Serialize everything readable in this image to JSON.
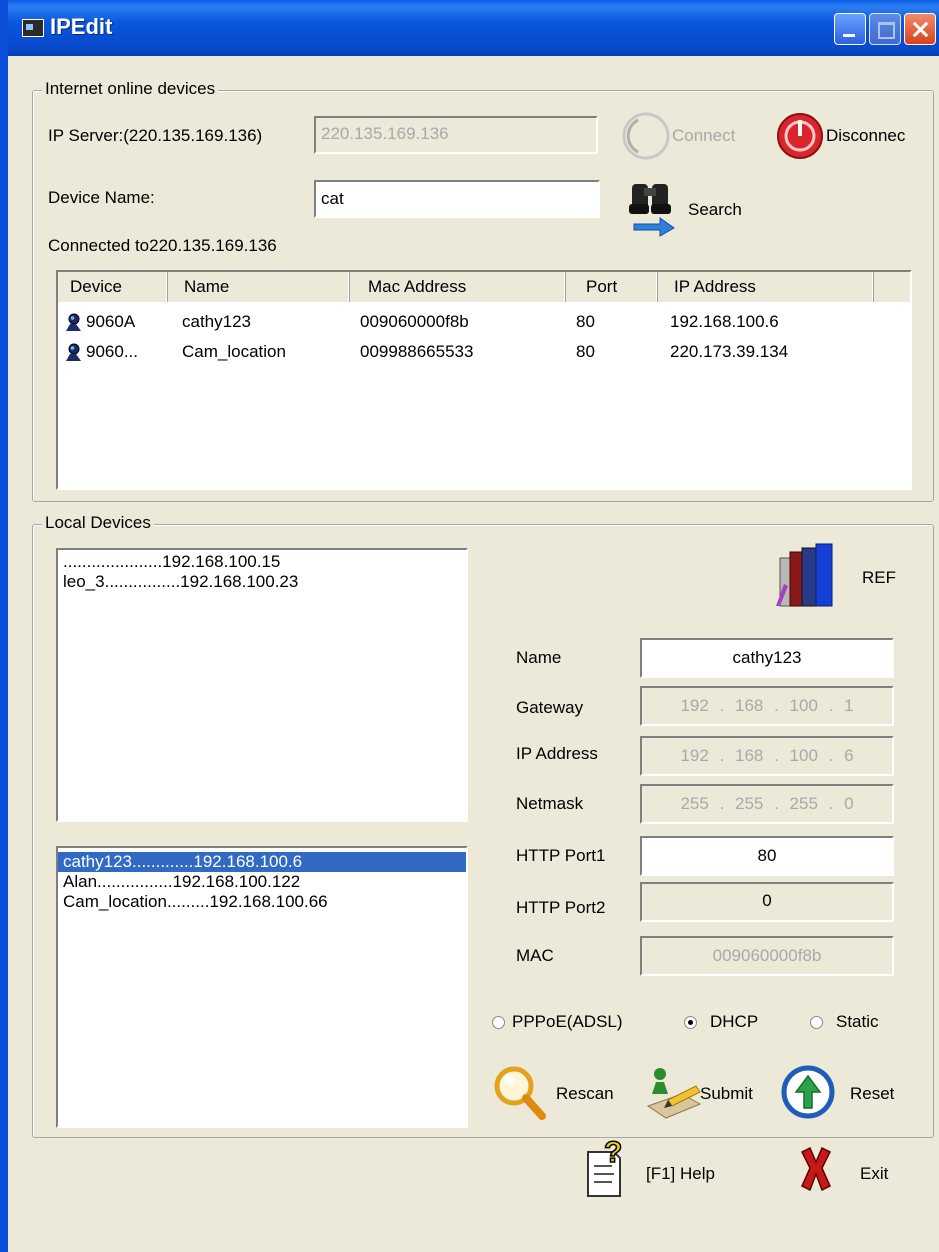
{
  "window": {
    "title": "IPEdit"
  },
  "online": {
    "legend": "Internet online devices",
    "ip_server_label": "IP Server:(220.135.169.136)",
    "ip_server_value": "220.135.169.136",
    "connect_label": "Connect",
    "disconnect_label": "Disconnec",
    "device_name_label": "Device Name:",
    "device_name_value": "cat",
    "search_label": "Search",
    "status": "Connected to220.135.169.136",
    "columns": [
      "Device",
      "Name",
      "Mac Address",
      "Port",
      "IP Address"
    ],
    "rows": [
      {
        "device": "9060A",
        "name": "cathy123",
        "mac": "009060000f8b",
        "port": "80",
        "ip": "192.168.100.6"
      },
      {
        "device": "9060...",
        "name": "Cam_location",
        "mac": "009988665533",
        "port": "80",
        "ip": "220.173.39.134"
      }
    ]
  },
  "local": {
    "legend": "Local Devices",
    "list_top": [
      ".....................192.168.100.15",
      "leo_3................192.168.100.23"
    ],
    "list_bottom": [
      {
        "text": "cathy123.............192.168.100.6",
        "selected": true
      },
      {
        "text": "Alan................192.168.100.122",
        "selected": false
      },
      {
        "text": "Cam_location.........192.168.100.66",
        "selected": false
      }
    ],
    "ref_label": "REF",
    "fields": {
      "name_label": "Name",
      "name_value": "cathy123",
      "gateway_label": "Gateway",
      "gateway_value": "192 . 168 . 100 . 1",
      "ip_label": "IP Address",
      "ip_value": "192 . 168 . 100 . 6",
      "netmask_label": "Netmask",
      "netmask_value": "255 . 255 . 255 . 0",
      "port1_label": "HTTP Port1",
      "port1_value": "80",
      "port2_label": "HTTP Port2",
      "port2_value": "0",
      "mac_label": "MAC",
      "mac_value": "009060000f8b"
    },
    "modes": {
      "pppoe": "PPPoE(ADSL)",
      "dhcp": "DHCP",
      "static": "Static",
      "selected": "DHCP"
    },
    "rescan_label": "Rescan",
    "submit_label": "Submit",
    "reset_label": "Reset"
  },
  "footer": {
    "help_label": "[F1] Help",
    "exit_label": "Exit"
  }
}
